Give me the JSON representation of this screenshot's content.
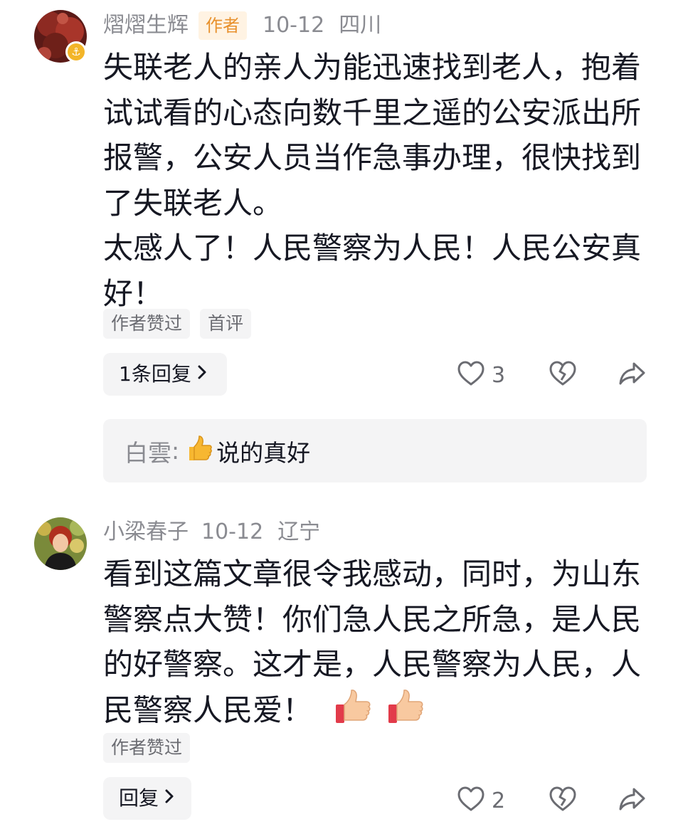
{
  "comments": [
    {
      "username": "熠熠生辉",
      "author_tag": "作者",
      "date": "10-12",
      "location": "四川",
      "text_para1": "失联老人的亲人为能迅速找到老人，抱着试试看的心态向数千里之遥的公安派出所报警，公安人员当作急事办理，很快找到了失联老人。",
      "text_para2": "太感人了！人民警察为人民！人民公安真好！",
      "tags": [
        "作者赞过",
        "首评"
      ],
      "reply_button": "1条回复",
      "like_count": "3",
      "sub_reply": {
        "name": "白雲",
        "separator": ":",
        "emoji": "thumbs-up-emoji",
        "text": "说的真好"
      }
    },
    {
      "username": "小梁春子",
      "date": "10-12",
      "location": "辽宁",
      "text": "看到这篇文章很令我感动，同时，为山东警察点大赞！你们急人民之所急，是人民的好警察。这才是，人民警察为人民，人民警察人民爱！",
      "emojis": [
        "thumbs-up-emoji",
        "thumbs-up-emoji"
      ],
      "tags": [
        "作者赞过"
      ],
      "reply_button": "回复",
      "like_count": "2"
    }
  ],
  "icons": {
    "like": "heart-outline-icon",
    "dislike": "broken-heart-icon",
    "share": "share-arrow-icon",
    "chevron": "chevron-right-icon",
    "badge": "gold-level-badge-icon"
  },
  "colors": {
    "author_tag_bg": "#fff3e3",
    "author_tag_text": "#e8912d",
    "meta_text": "#8a8b91",
    "body_text": "#161823",
    "chip_bg": "#f4f4f5",
    "badge_gold": "#f3b529"
  }
}
